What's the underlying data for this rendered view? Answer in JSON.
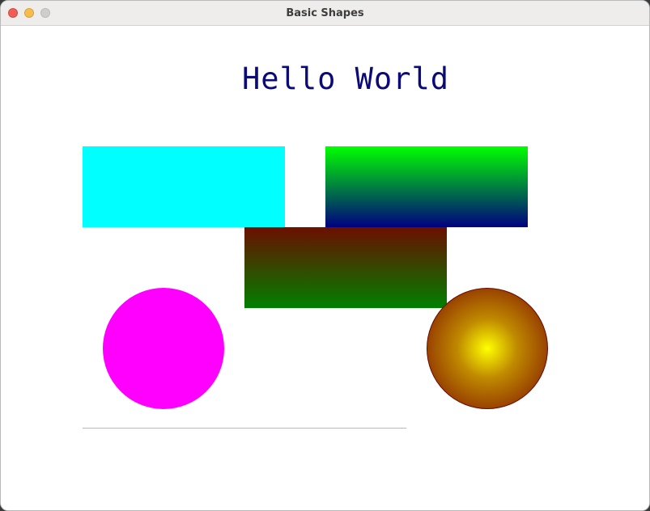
{
  "window": {
    "title": "Basic Shapes"
  },
  "canvas": {
    "text": "Hello World",
    "text_color": "#0a0a78",
    "shapes": {
      "rect_1_color": "#00ffff",
      "rect_2_gradient": [
        "#00ff00",
        "#000080"
      ],
      "rect_3_gradient": [
        "#6b0f00",
        "#008000"
      ],
      "circle_1_color": "#ff00ff",
      "circle_2_gradient": [
        "#ffff00",
        "#7a0a00"
      ],
      "line_color": "#ff9a9a"
    }
  }
}
